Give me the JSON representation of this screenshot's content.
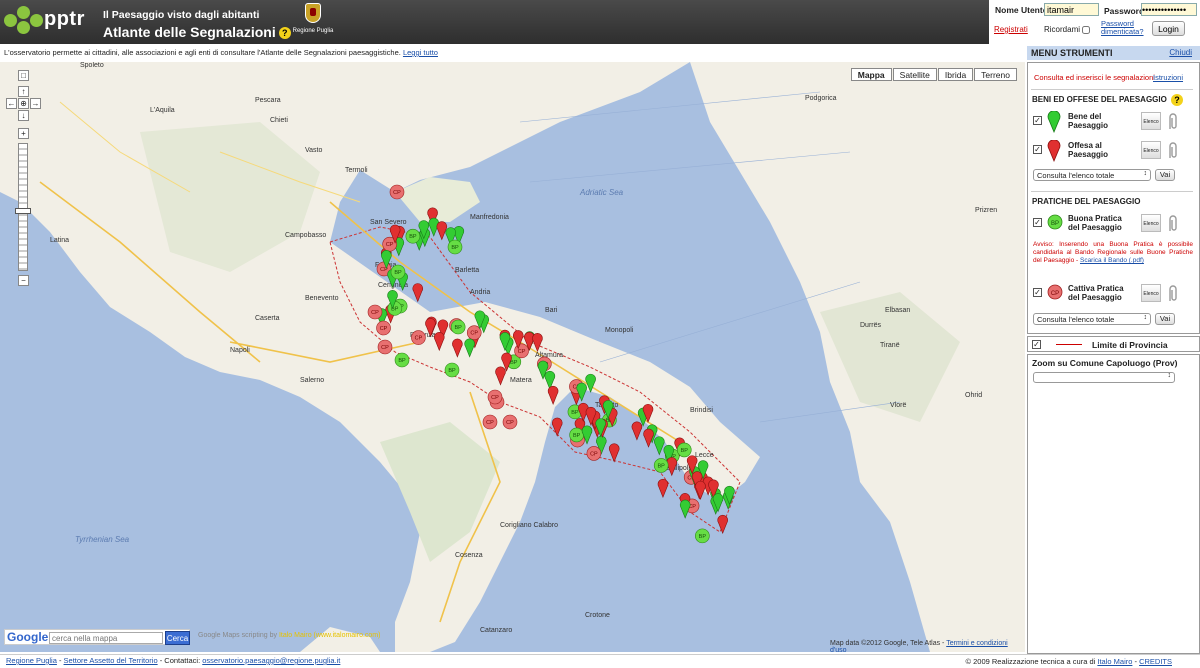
{
  "header": {
    "logo_text": "pptr",
    "subtitle": "Il Paesaggio visto dagli abitanti",
    "title": "Atlante delle Segnalazioni",
    "region_logo_label": "Regione Puglia"
  },
  "login": {
    "user_label": "Nome Utente:",
    "user_value": "itamair",
    "password_label": "Password:",
    "password_value": "••••••••••••••",
    "register_link": "Registrati",
    "remember_label": "Ricordami",
    "forgot_link": "Password dimenticata?",
    "login_button": "Login"
  },
  "infobar": {
    "text": "L'osservatorio permette ai cittadini, alle associazioni e agli enti di consultare l'Atlante delle Segnalazioni paesaggistiche.",
    "link": "Leggi tutto"
  },
  "map": {
    "types": [
      "Mappa",
      "Satellite",
      "Ibrida",
      "Terreno"
    ],
    "active_type": "Mappa",
    "search_logo": "Google",
    "search_placeholder": "cerca nella mappa",
    "search_button": "Cerca",
    "credit_prefix": "Google Maps scripting by",
    "credit_name": "Italo Mairo (www.italomairo.com)",
    "data_credit": "Map data ©2012 Google, Tele Atlas -",
    "terms_link": "Termini e condizioni d'uso",
    "labels": [
      {
        "t": "Spoleto"
      },
      {
        "t": "Pescara"
      },
      {
        "t": "L'Aquila"
      },
      {
        "t": "Chieti"
      },
      {
        "t": "Campobasso"
      },
      {
        "t": "Benevento"
      },
      {
        "t": "Caserta"
      },
      {
        "t": "Napoli"
      },
      {
        "t": "Salerno"
      },
      {
        "t": "Potenza"
      },
      {
        "t": "Foggia"
      },
      {
        "t": "Cerignola"
      },
      {
        "t": "Barletta"
      },
      {
        "t": "Andria"
      },
      {
        "t": "Bari"
      },
      {
        "t": "Matera"
      },
      {
        "t": "Taranto"
      },
      {
        "t": "Brindisi"
      },
      {
        "t": "Lecce"
      },
      {
        "t": "Gallipoli"
      },
      {
        "t": "Corigliano Calabro"
      },
      {
        "t": "Crotone"
      },
      {
        "t": "Cosenza"
      },
      {
        "t": "Catanzaro"
      },
      {
        "t": "Tyrrhenian Sea"
      },
      {
        "t": "Adriatic Sea"
      },
      {
        "t": "Podgorica"
      },
      {
        "t": "Tiranë"
      },
      {
        "t": "Elbasan"
      },
      {
        "t": "Durrës"
      },
      {
        "t": "Prizren"
      },
      {
        "t": "Ohrid"
      },
      {
        "t": "Vlorë"
      },
      {
        "t": "Latina"
      },
      {
        "t": "Termoli"
      },
      {
        "t": "San Severo"
      },
      {
        "t": "Manfredonia"
      },
      {
        "t": "Altamura"
      },
      {
        "t": "Monopoli"
      },
      {
        "t": "Vasto"
      }
    ]
  },
  "sidebar": {
    "menu_title": "MENU STRUMENTI",
    "hide_link": "Chiudi",
    "consult_text": "Consulta ed inserisci le segnalazioni",
    "instructions_link": "Istruzioni",
    "beni_title": "BENI ED OFFESE DEL PAESAGGIO",
    "bene_label": "Bene del Paesaggio",
    "offesa_label": "Offesa al Paesaggio",
    "elenco": "Elenco",
    "select_total": "Consulta l'elenco totale",
    "vai": "Vai",
    "pratiche_title": "PRATICHE DEL PAESAGGIO",
    "buona_label": "Buona Pratica del Paesaggio",
    "buona_badge": "BP",
    "warning_text": "Avviso: Inserendo una Buona Pratica è possibile candidarla al Bando Regionale sulle Buone Pratiche del Paesaggio -",
    "warning_link": "Scarica il Bando (.pdf)",
    "cattiva_label": "Cattiva Pratica del Paesaggio",
    "cattiva_badge": "CP",
    "limite_label": "Limite di Provincia",
    "zoom_label": "Zoom su Comune Capoluogo (Prov)"
  },
  "footer": {
    "link1": "Regione Puglia",
    "link2": "Settore Assetto del Territorio",
    "contact_prefix": "Contattaci:",
    "email": "osservatorio.paesaggio@regione.puglia.it",
    "right_text": "© 2009 Realizzazione tecnica a cura di",
    "author": "Italo Mairo",
    "credits": "CREDITS"
  },
  "colors": {
    "header_bg": "#3a3a3a",
    "sea": "#a8bfe0",
    "land": "#f2efe6",
    "bene_green": "#33cc33",
    "offesa_red": "#e03030",
    "cp_circle": "#e87070",
    "bp_circle": "#66dd44"
  }
}
